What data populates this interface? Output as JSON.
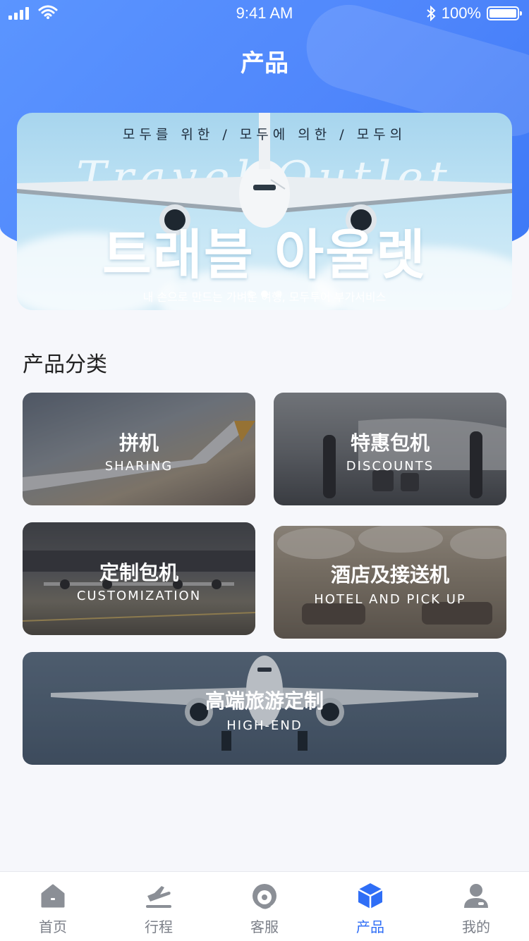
{
  "status_bar": {
    "time": "9:41 AM",
    "battery": "100%",
    "battery_level": 1.0
  },
  "header": {
    "title": "产品"
  },
  "banner": {
    "top_text": "모두를 위한 / 모두에 의한 / 모두의",
    "script_text": "Travel Outlet",
    "headline": "트래블 아울렛",
    "caption": "내 손으로 만드는 가벼운 여행, 모두투어 부가서비스",
    "slide_count": 3,
    "active_slide": 1
  },
  "section": {
    "title": "产品分类"
  },
  "categories": [
    {
      "cn": "拼机",
      "en": "SHARING"
    },
    {
      "cn": "特惠包机",
      "en": "DISCOUNTS"
    },
    {
      "cn": "定制包机",
      "en": "CUSTOMIZATION"
    },
    {
      "cn": "酒店及接送机",
      "en": "HOTEL AND PICK UP"
    },
    {
      "cn": "高端旅游定制",
      "en": "HIGH-END"
    }
  ],
  "tabbar": {
    "items": [
      {
        "label": "首页",
        "icon": "home-icon"
      },
      {
        "label": "行程",
        "icon": "plane-departure-icon"
      },
      {
        "label": "客服",
        "icon": "headset-icon"
      },
      {
        "label": "产品",
        "icon": "cube-icon"
      },
      {
        "label": "我的",
        "icon": "user-icon"
      }
    ],
    "active_index": 3,
    "active_color": "#2f6ef6",
    "inactive_color": "#7b7f88"
  }
}
